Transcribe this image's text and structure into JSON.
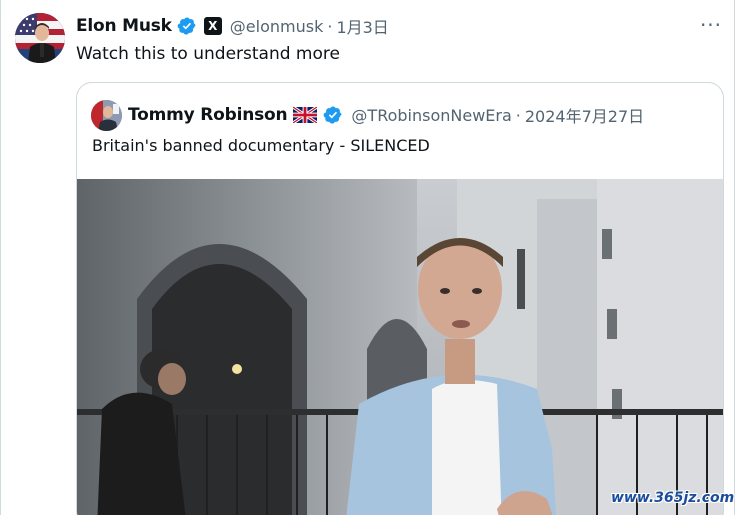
{
  "tweet": {
    "author_name": "Elon Musk",
    "author_handle": "@elonmusk",
    "separator": "·",
    "date": "1月3日",
    "text": "Watch this to understand more",
    "affiliation_badge": "X",
    "more_label": "···"
  },
  "quoted_tweet": {
    "author_name": "Tommy Robinson",
    "author_handle": "@TRobinsonNewEra",
    "separator": "·",
    "date": "2024年7月27日",
    "text": "Britain's banned documentary - SILENCED",
    "flag_icon": "uk-flag-icon",
    "media_description_icon": "video-thumbnail"
  },
  "watermark": "www.365jz.com",
  "colors": {
    "verified_blue": "#1d9bf0",
    "secondary_text": "#536471",
    "border": "#cfd9de"
  }
}
